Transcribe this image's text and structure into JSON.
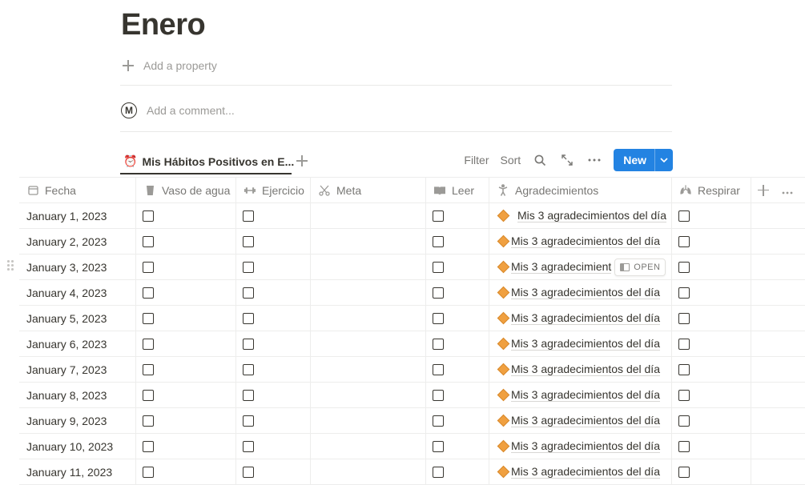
{
  "page": {
    "title": "Enero",
    "add_property": "Add a property",
    "add_comment": "Add a comment...",
    "avatar_letter": "M"
  },
  "view": {
    "tab_label": "Mis Hábitos Positivos en E...",
    "filter": "Filter",
    "sort": "Sort",
    "new": "New"
  },
  "columns": [
    {
      "label": "Fecha",
      "icon": "calendar-icon"
    },
    {
      "label": "Vaso de agua",
      "icon": "glass-icon"
    },
    {
      "label": "Ejercicio",
      "icon": "dumbbell-icon"
    },
    {
      "label": "Meta",
      "icon": "scissors-icon"
    },
    {
      "label": "Leer",
      "icon": "book-icon"
    },
    {
      "label": "Agradecimientos",
      "icon": "person-icon"
    },
    {
      "label": "Respirar",
      "icon": "lungs-icon"
    }
  ],
  "rows": [
    {
      "fecha": "January 1, 2023",
      "agradecimiento": "Mis 3 agradecimientos del día"
    },
    {
      "fecha": "January 2, 2023",
      "agradecimiento": "Mis 3 agradecimientos del día"
    },
    {
      "fecha": "January 3, 2023",
      "agradecimiento": "Mis 3 agradecimient",
      "open_label": "OPEN"
    },
    {
      "fecha": "January 4, 2023",
      "agradecimiento": "Mis 3 agradecimientos del día"
    },
    {
      "fecha": "January 5, 2023",
      "agradecimiento": "Mis 3 agradecimientos del día"
    },
    {
      "fecha": "January 6, 2023",
      "agradecimiento": "Mis 3 agradecimientos del día"
    },
    {
      "fecha": "January 7, 2023",
      "agradecimiento": "Mis 3 agradecimientos del día"
    },
    {
      "fecha": "January 8, 2023",
      "agradecimiento": "Mis 3 agradecimientos del día"
    },
    {
      "fecha": "January 9, 2023",
      "agradecimiento": "Mis 3 agradecimientos del día"
    },
    {
      "fecha": "January 10, 2023",
      "agradecimiento": "Mis 3 agradecimientos del día"
    },
    {
      "fecha": "January 11, 2023",
      "agradecimiento": "Mis 3 agradecimientos del día"
    }
  ],
  "colors": {
    "accent": "#2383e2",
    "text": "#37352f",
    "muted": "#9b9a97",
    "diamond": "#f0a040"
  }
}
